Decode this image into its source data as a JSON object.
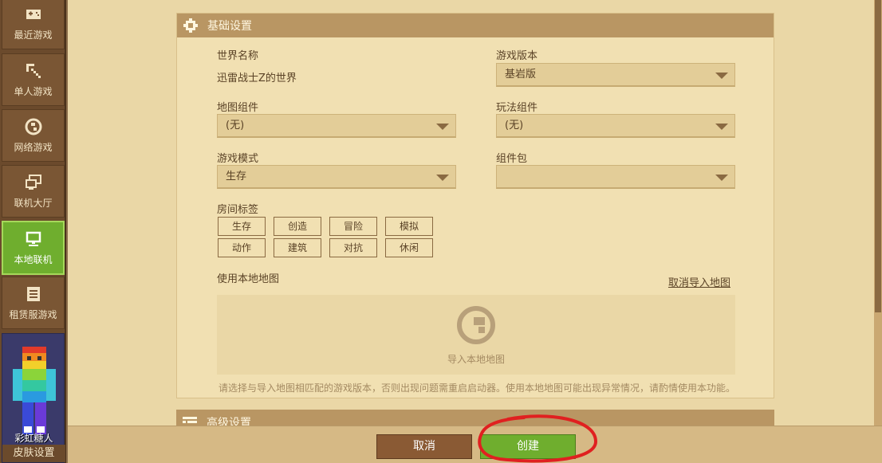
{
  "sidebar": {
    "items": [
      {
        "label": "最近游戏",
        "icon": "gamepad-icon"
      },
      {
        "label": "单人游戏",
        "icon": "pickaxe-icon"
      },
      {
        "label": "网络游戏",
        "icon": "globe-icon"
      },
      {
        "label": "联机大厅",
        "icon": "monitors-icon"
      },
      {
        "label": "本地联机",
        "icon": "monitor-icon",
        "active": true
      },
      {
        "label": "租赁服游戏",
        "icon": "server-list-icon"
      }
    ],
    "skin": {
      "name": "彩虹糖人",
      "button": "皮肤设置"
    }
  },
  "basic_settings": {
    "title": "基础设置",
    "world_name_label": "世界名称",
    "world_name_value": "迅雷战士Z的世界",
    "game_version_label": "游戏版本",
    "game_version_value": "基岩版",
    "map_component_label": "地图组件",
    "map_component_value": "(无)",
    "gameplay_component_label": "玩法组件",
    "gameplay_component_value": "(无)",
    "game_mode_label": "游戏模式",
    "game_mode_value": "生存",
    "component_pack_label": "组件包",
    "component_pack_value": "",
    "room_tags_label": "房间标签",
    "room_tags": [
      "生存",
      "创造",
      "冒险",
      "模拟",
      "动作",
      "建筑",
      "对抗",
      "休闲"
    ],
    "local_map_label": "使用本地地图",
    "cancel_import": "取消导入地图",
    "import_label": "导入本地地图",
    "notice": "请选择与导入地图相匹配的游戏版本，否则出现问题需重启启动器。使用本地地图可能出现异常情况，请酌情使用本功能。"
  },
  "advanced_settings": {
    "title": "高级设置"
  },
  "footer": {
    "cancel": "取消",
    "create": "创建"
  },
  "colors": {
    "active_green": "#6fae2e",
    "panel_header": "#b99663",
    "annotation_red": "#e02020"
  }
}
